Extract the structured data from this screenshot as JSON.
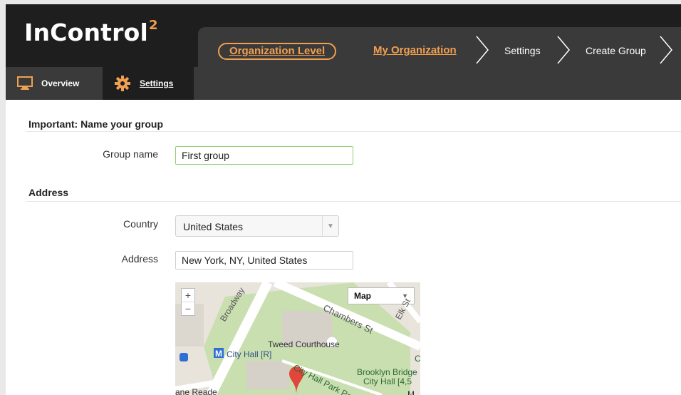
{
  "app": {
    "logo": "InControl",
    "logo_sup": "2"
  },
  "breadcrumb": {
    "level": "Organization Level",
    "items": [
      "My Organization",
      "Settings",
      "Create Group"
    ]
  },
  "tabs": [
    {
      "label": "Overview",
      "icon": "monitor-icon"
    },
    {
      "label": "Settings",
      "icon": "gear-icon",
      "active": true
    }
  ],
  "group_section": {
    "title": "Important: Name your group",
    "name_label": "Group name",
    "name_value": "First group"
  },
  "address_section": {
    "title": "Address",
    "country_label": "Country",
    "country_value": "United States",
    "address_label": "Address",
    "address_value": "New York, NY, United States"
  },
  "map": {
    "zoom_in": "+",
    "zoom_out": "−",
    "type": "Map",
    "labels": {
      "broadway": "Broadway",
      "chambers": "Chambers St",
      "elk": "Elk St",
      "tweed": "Tweed Courthouse",
      "cityhall_r": "City Hall [R]",
      "cityhall_park": "City Hall Park Path",
      "bb1": "Brooklyn Bridge",
      "bb2": "City Hall [4,5",
      "lane": "ane Reade",
      "ch": "Ch",
      "m": "M"
    },
    "colors": {
      "park": "#c9dfb0",
      "road": "#ffffff",
      "pin": "#e0463a",
      "subway": "#2f6fd6"
    }
  },
  "colors": {
    "accent": "#f0a050",
    "header": "#1e1e1e",
    "bar": "#3a3a3a"
  }
}
